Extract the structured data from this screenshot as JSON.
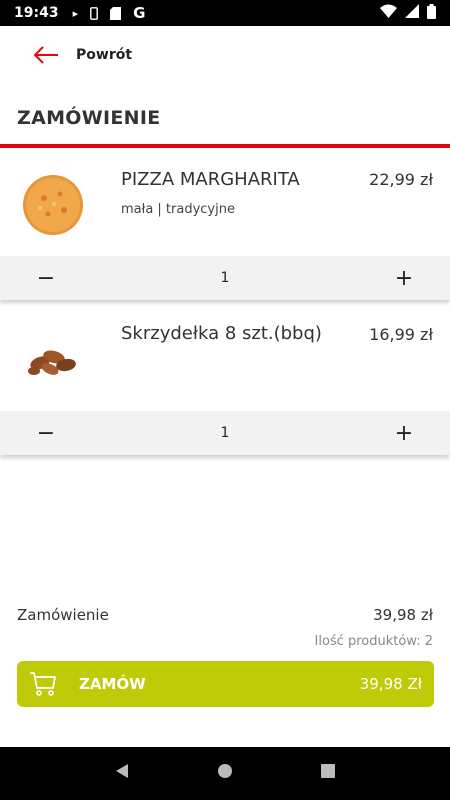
{
  "status_bar": {
    "time": "19:43",
    "g_label": "G"
  },
  "header": {
    "back_label": "Powrót"
  },
  "page": {
    "title": "ZAMÓWIENIE"
  },
  "items": [
    {
      "name": "PIZZA MARGHARITA",
      "price": "22,99 zł",
      "description": "mała | tradycyjne",
      "quantity": "1",
      "minus": "−",
      "plus": "+"
    },
    {
      "name": "Skrzydełka 8 szt.(bbq)",
      "price": "16,99 zł",
      "description": "",
      "quantity": "1",
      "minus": "−",
      "plus": "+"
    }
  ],
  "summary": {
    "label": "Zamówienie",
    "value": "39,98 zł",
    "count": "Ilość produktów: 2"
  },
  "order_button": {
    "label": "ZAMÓW",
    "total": "39,98 Zł"
  },
  "colors": {
    "accent_red": "#e30613",
    "button_green": "#bfcb08"
  }
}
